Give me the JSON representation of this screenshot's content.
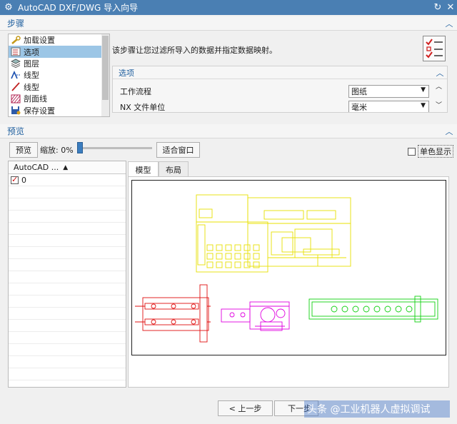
{
  "window": {
    "title": "AutoCAD DXF/DWG 导入向导",
    "icons": {
      "app": "gear-icon",
      "reset": "reset-icon",
      "close": "close-icon"
    }
  },
  "steps": {
    "section_title": "步骤",
    "items": [
      {
        "label": "加载设置",
        "icon": "wrench-icon"
      },
      {
        "label": "选项",
        "icon": "options-icon",
        "selected": true
      },
      {
        "label": "图层",
        "icon": "layers-icon"
      },
      {
        "label": "线型",
        "icon": "linetype-icon"
      },
      {
        "label": "线型",
        "icon": "linewidth-icon"
      },
      {
        "label": "剖面线",
        "icon": "hatch-icon"
      },
      {
        "label": "保存设置",
        "icon": "save-settings-icon"
      }
    ],
    "description": "该步骤让您过滤所导入的数据并指定数据映射。"
  },
  "options": {
    "section_title": "选项",
    "rows": [
      {
        "label": "工作流程",
        "value": "图纸"
      },
      {
        "label": "NX 文件单位",
        "value": "毫米"
      }
    ]
  },
  "preview": {
    "section_title": "预览",
    "preview_button": "预览",
    "zoom_label": "缩放:",
    "zoom_value": "0%",
    "zoom_fraction": 0.0,
    "fit_button": "适合窗口",
    "monochrome_label": "单色显示",
    "monochrome_checked": false,
    "layer_column_header": "AutoCAD ...",
    "layers": [
      {
        "name": "0",
        "checked": true
      }
    ],
    "tabs": [
      {
        "label": "模型",
        "active": true
      },
      {
        "label": "布局",
        "active": false
      }
    ]
  },
  "footer": {
    "back_button": "< 上一步",
    "next_button": "下一步",
    "watermark": "头条 @工业机器人虚拟调试"
  },
  "colors": {
    "titlebar": "#4a7fb3",
    "accent": "#1f5f9e",
    "selected_row": "#9cc6e6",
    "drawing_yellow": "#e8e000",
    "drawing_red": "#e01010",
    "drawing_magenta": "#e000e0",
    "drawing_green": "#10d010"
  }
}
